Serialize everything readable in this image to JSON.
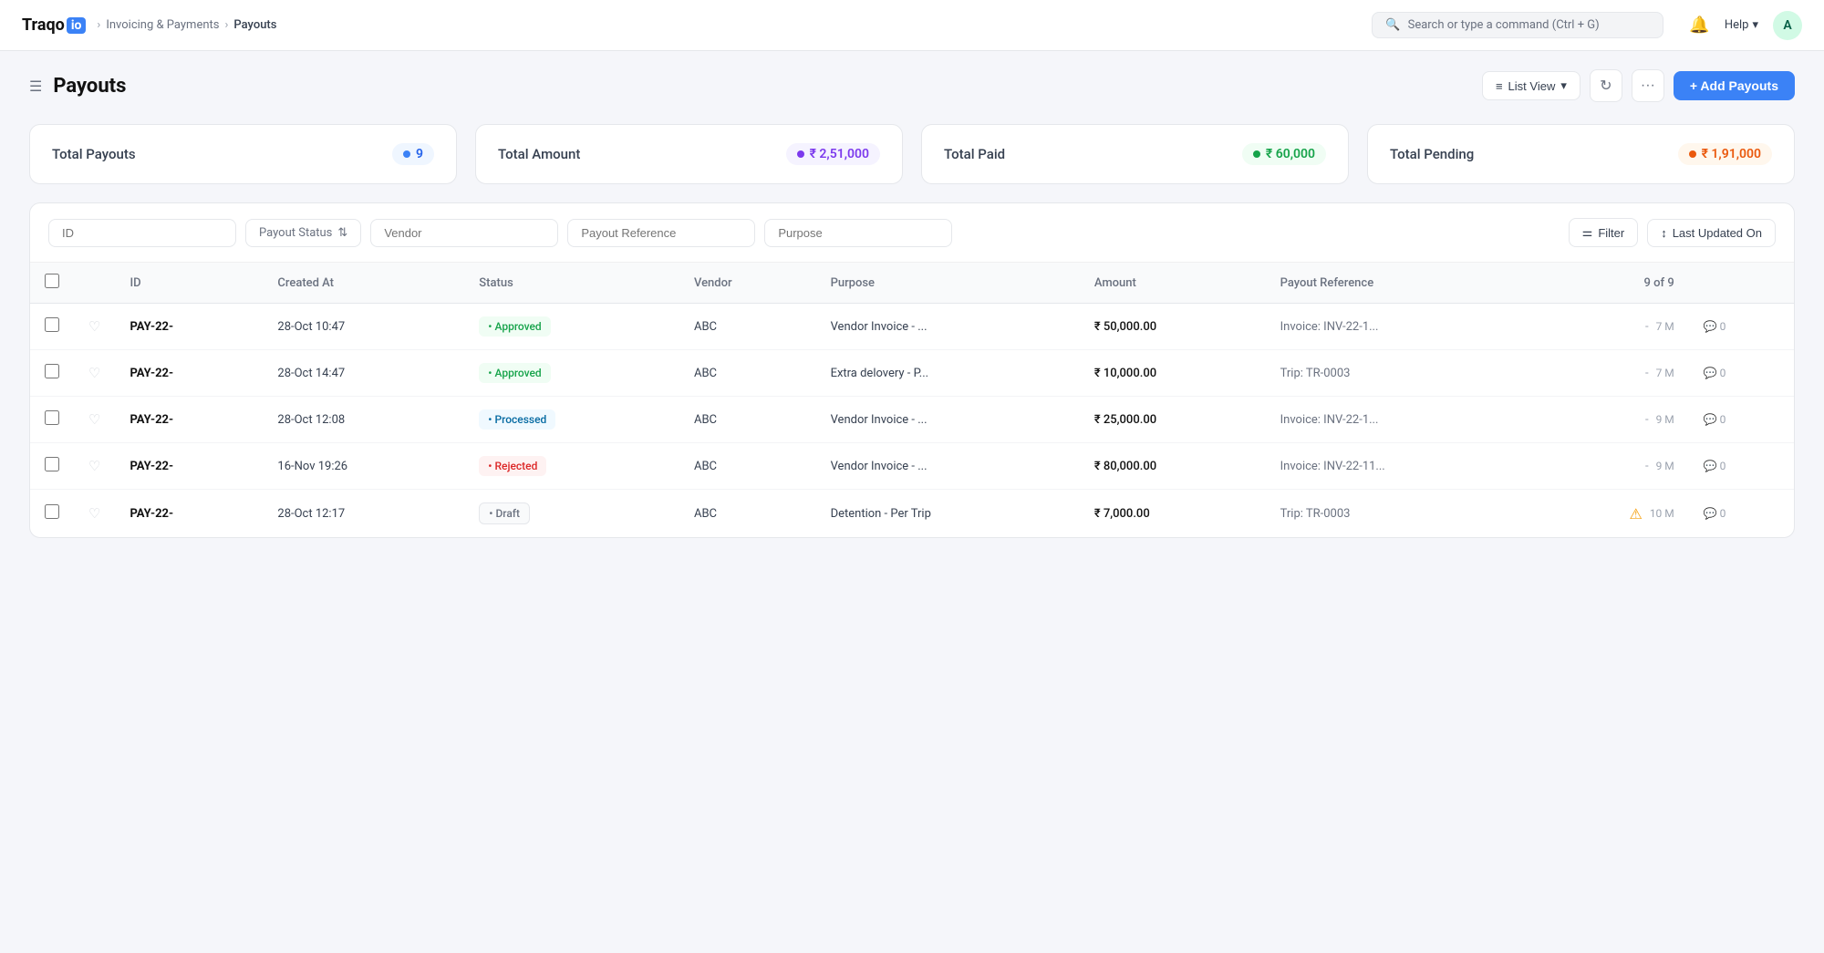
{
  "app": {
    "logo_text": "Traqo",
    "logo_dot": "io"
  },
  "breadcrumb": {
    "parent": "Invoicing & Payments",
    "current": "Payouts"
  },
  "search": {
    "placeholder": "Search or type a command (Ctrl + G)"
  },
  "nav": {
    "help_label": "Help",
    "avatar_label": "A"
  },
  "header": {
    "title": "Payouts",
    "list_view_label": "List View",
    "add_button_label": "+ Add Payouts"
  },
  "stats": [
    {
      "label": "Total Payouts",
      "value": "9",
      "badge_class": "badge-blue",
      "dot_class": "dot-blue"
    },
    {
      "label": "Total Amount",
      "value": "₹ 2,51,000",
      "badge_class": "badge-purple",
      "dot_class": "dot-purple"
    },
    {
      "label": "Total Paid",
      "value": "₹ 60,000",
      "badge_class": "badge-green",
      "dot_class": "dot-green"
    },
    {
      "label": "Total Pending",
      "value": "₹ 1,91,000",
      "badge_class": "badge-orange",
      "dot_class": "dot-orange"
    }
  ],
  "filters": {
    "id_placeholder": "ID",
    "status_placeholder": "Payout Status",
    "vendor_placeholder": "Vendor",
    "reference_placeholder": "Payout Reference",
    "purpose_placeholder": "Purpose",
    "filter_label": "Filter",
    "sort_label": "Last Updated On"
  },
  "table": {
    "columns": [
      "",
      "",
      "ID",
      "Created At",
      "Status",
      "Vendor",
      "Purpose",
      "Amount",
      "Payout Reference",
      "",
      ""
    ],
    "count_label": "9 of 9",
    "rows": [
      {
        "id": "PAY-22-",
        "created_at": "28-Oct 10:47",
        "status": "Approved",
        "status_class": "status-approved",
        "vendor": "ABC",
        "purpose": "Vendor Invoice - ...",
        "amount": "₹ 50,000.00",
        "reference": "Invoice: INV-22-1...",
        "time": "7 M",
        "comments": "0",
        "warn": false
      },
      {
        "id": "PAY-22-",
        "created_at": "28-Oct 14:47",
        "status": "Approved",
        "status_class": "status-approved",
        "vendor": "ABC",
        "purpose": "Extra delovery - P...",
        "amount": "₹ 10,000.00",
        "reference": "Trip: TR-0003",
        "time": "7 M",
        "comments": "0",
        "warn": false
      },
      {
        "id": "PAY-22-",
        "created_at": "28-Oct 12:08",
        "status": "Processed",
        "status_class": "status-processed",
        "vendor": "ABC",
        "purpose": "Vendor Invoice - ...",
        "amount": "₹ 25,000.00",
        "reference": "Invoice: INV-22-1...",
        "time": "9 M",
        "comments": "0",
        "warn": false
      },
      {
        "id": "PAY-22-",
        "created_at": "16-Nov 19:26",
        "status": "Rejected",
        "status_class": "status-rejected",
        "vendor": "ABC",
        "purpose": "Vendor Invoice - ...",
        "amount": "₹ 80,000.00",
        "reference": "Invoice: INV-22-11...",
        "time": "9 M",
        "comments": "0",
        "warn": false
      },
      {
        "id": "PAY-22-",
        "created_at": "28-Oct 12:17",
        "status": "Draft",
        "status_class": "status-draft",
        "vendor": "ABC",
        "purpose": "Detention - Per Trip",
        "amount": "₹ 7,000.00",
        "reference": "Trip: TR-0003",
        "time": "10 M",
        "comments": "0",
        "warn": true
      }
    ]
  }
}
